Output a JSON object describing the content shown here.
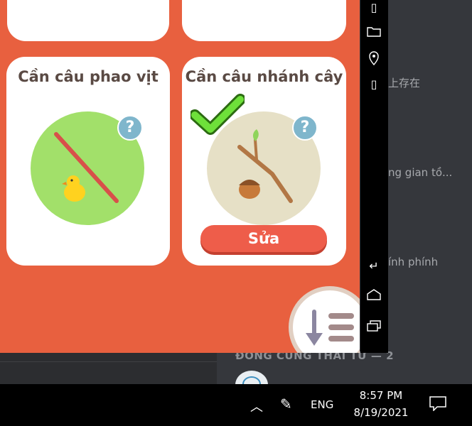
{
  "background_app": {
    "snippets": [
      "上存在",
      "ng gian tồ...",
      "ính phính"
    ],
    "section_header": "ĐỒNG CUNG THÁI TỬ — 2"
  },
  "game": {
    "cards": [
      {
        "title": "Cần câu phao vịt",
        "help": "?",
        "owned": false
      },
      {
        "title": "Cần câu nhánh cây",
        "help": "?",
        "owned": true,
        "edit_label": "Sửa"
      }
    ]
  },
  "emulator_toolbar": {
    "icons": [
      "vibrate-icon",
      "folder-icon",
      "location-icon",
      "shake-icon",
      "back-icon",
      "home-icon",
      "recents-icon"
    ]
  },
  "taskbar": {
    "time": "8:57 PM",
    "date": "8/19/2021",
    "language": "ENG",
    "tray_up": "︿",
    "pen_icon": "✎"
  },
  "colors": {
    "game_bg": "#e8603f",
    "edit_button": "#ee5d4a",
    "check_green": "#5fcf2a",
    "help_blue": "#7fb6cc"
  }
}
